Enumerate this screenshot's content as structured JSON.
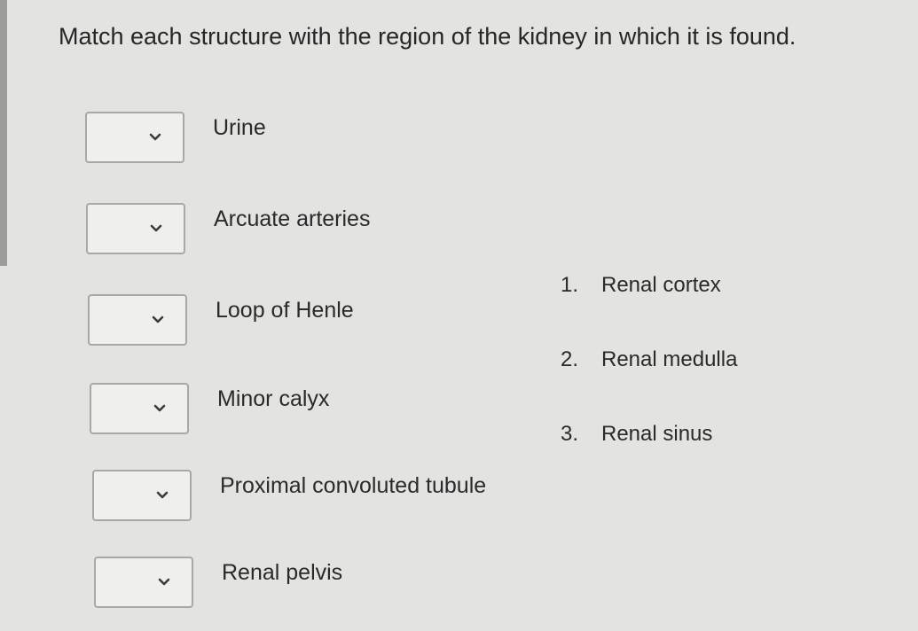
{
  "question": {
    "prompt": "Match each structure with the region of the kidney in which it is found."
  },
  "structures": [
    {
      "label": "Urine",
      "selected": ""
    },
    {
      "label": "Arcuate arteries",
      "selected": ""
    },
    {
      "label": "Loop of Henle",
      "selected": ""
    },
    {
      "label": "Minor calyx",
      "selected": ""
    },
    {
      "label": "Proximal convoluted tubule",
      "selected": ""
    },
    {
      "label": "Renal pelvis",
      "selected": ""
    }
  ],
  "regions": [
    {
      "number": "1.",
      "label": "Renal cortex"
    },
    {
      "number": "2.",
      "label": "Renal medulla"
    },
    {
      "number": "3.",
      "label": "Renal sinus"
    }
  ],
  "icons": {
    "dropdown": "chevron-down-icon"
  }
}
